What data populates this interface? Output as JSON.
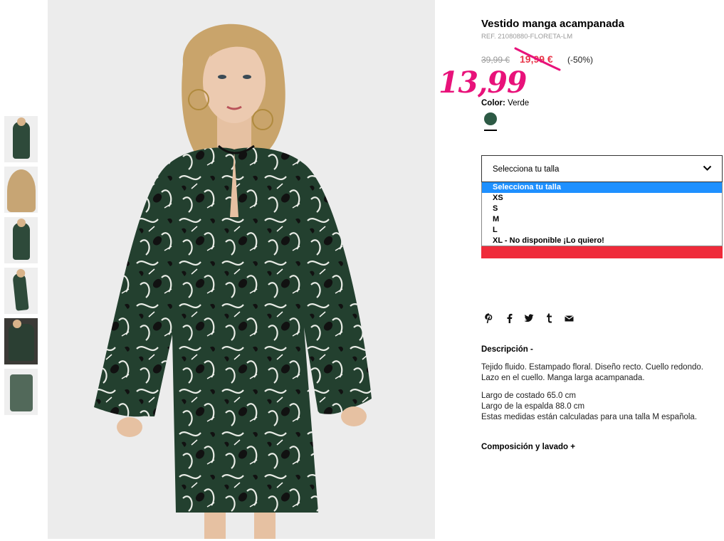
{
  "product": {
    "title": "Vestido manga acampanada",
    "ref": "REF. 21080880-FLORETA-LM",
    "price_old": "39,99 €",
    "price_sale": "19,99 €",
    "discount": "(-50%)",
    "handwritten_price": "13,99"
  },
  "color": {
    "label": "Color:",
    "value": "Verde",
    "swatch_hex": "#2d5a45"
  },
  "size_select": {
    "placeholder": "Selecciona tu talla",
    "options": [
      "Selecciona tu talla",
      "XS",
      "S",
      "M",
      "L",
      "XL - No disponible ¡Lo quiero!"
    ],
    "highlighted_index": 0
  },
  "social": {
    "icons": [
      "pinterest-icon",
      "facebook-icon",
      "twitter-icon",
      "tumblr-icon",
      "email-icon"
    ]
  },
  "description": {
    "heading": "Descripción  -",
    "line1": "Tejido fluido. Estampado floral. Diseño recto. Cuello redondo.",
    "line2": "Lazo en el cuello. Manga larga acampanada.",
    "line3": "Largo de costado 65.0 cm",
    "line4": "Largo de la espalda 88.0 cm",
    "line5": "Estas medidas están calculadas para una talla M española."
  },
  "composition": {
    "heading": "Composición y lavado  +"
  },
  "colors": {
    "sale_red": "#e8364a",
    "handwritten_pink": "#e8127a",
    "option_highlight": "#1e90ff",
    "button_red": "#ef2b3a"
  }
}
